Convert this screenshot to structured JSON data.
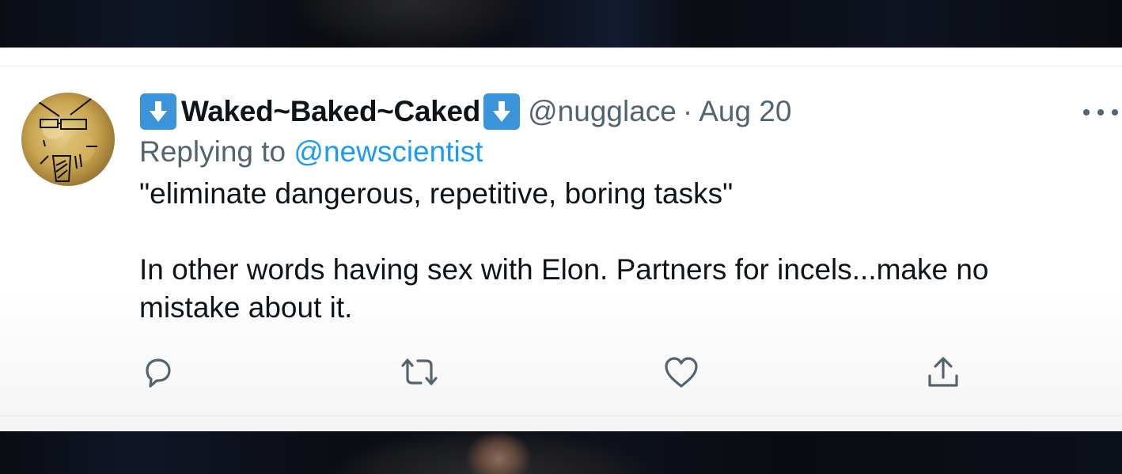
{
  "tweet": {
    "display_name": "Waked~Baked~Caked",
    "handle": "@nugglace",
    "separator": "·",
    "date": "Aug 20",
    "replying_prefix": "Replying to",
    "replying_to": "@newscientist",
    "body_line1": "\"eliminate dangerous, repetitive, boring tasks\"",
    "body_line2": "In other words having sex with Elon. Partners for incels...make no mistake about it."
  },
  "icons": {
    "name_badge_left": "down-arrow-icon",
    "name_badge_right": "down-arrow-icon",
    "more": "more-horizontal-icon",
    "reply": "reply-icon",
    "retweet": "retweet-icon",
    "like": "heart-icon",
    "share": "share-icon"
  },
  "colors": {
    "text_primary": "#0f1419",
    "text_secondary": "#536471",
    "link": "#1d9bf0",
    "badge": "#3b94d9"
  }
}
